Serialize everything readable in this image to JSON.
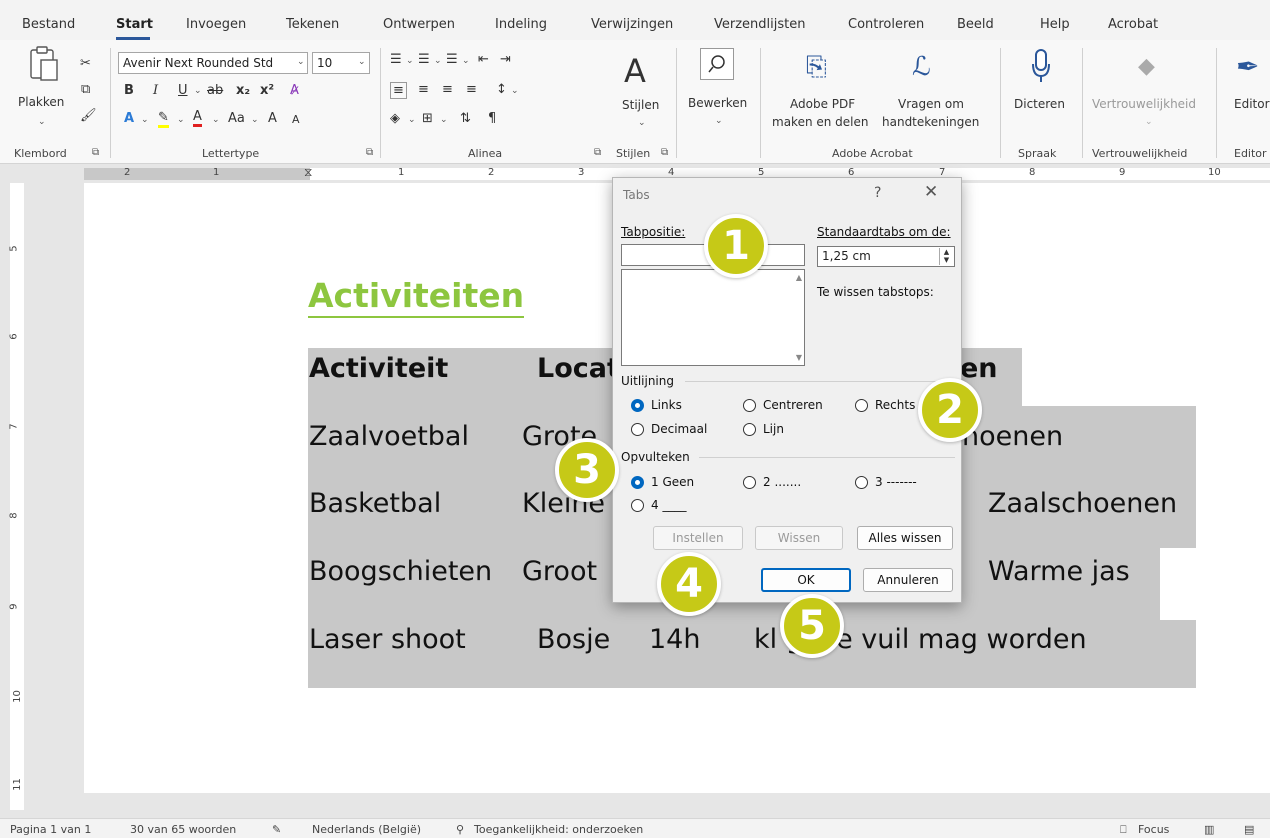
{
  "menu": {
    "tabs": [
      "Bestand",
      "Start",
      "Invoegen",
      "Tekenen",
      "Ontwerpen",
      "Indeling",
      "Verwijzingen",
      "Verzendlijsten",
      "Controleren",
      "Beeld",
      "Help",
      "Acrobat"
    ],
    "active": "Start"
  },
  "ribbon": {
    "clipboard": {
      "paste_label": "Plakken",
      "group_label": "Klembord"
    },
    "font": {
      "font_name": "Avenir Next Rounded Std",
      "font_size": "10",
      "group_label": "Lettertype",
      "bold": "B",
      "italic": "I",
      "underline": "U",
      "strike": "ab",
      "change_case": "Aa",
      "grow": "A",
      "shrink": "A"
    },
    "paragraph": {
      "group_label": "Alinea",
      "pilcrow": "¶"
    },
    "styles": {
      "label": "Stijlen",
      "group_label": "Stijlen"
    },
    "editing": {
      "label": "Bewerken"
    },
    "acrobat": {
      "pdf_label_1": "Adobe PDF",
      "pdf_label_2": "maken en delen",
      "sign_label_1": "Vragen om",
      "sign_label_2": "handtekeningen",
      "group_label": "Adobe Acrobat"
    },
    "voice": {
      "label": "Dicteren",
      "group_label": "Spraak"
    },
    "sensitivity": {
      "label": "Vertrouwelijkheid",
      "group_label": "Vertrouwelijkheid"
    },
    "editor": {
      "label": "Editor",
      "group_label": "Editor"
    }
  },
  "ruler": {
    "numbers": [
      "2",
      "1",
      "1",
      "2",
      "3",
      "4",
      "5",
      "6",
      "7",
      "8",
      "9",
      "10"
    ]
  },
  "vruler": {
    "numbers": [
      "5",
      "6",
      "7",
      "8",
      "9",
      "10",
      "11"
    ]
  },
  "document": {
    "heading": "Activiteiten",
    "rows": [
      {
        "a": "Activiteit",
        "b": "Locat",
        "c": "",
        "d": "en"
      },
      {
        "a": "Zaalvoetbal",
        "b": "Grote",
        "c": "",
        "d": "noenen"
      },
      {
        "a": "Basketbal",
        "b": "Kleine",
        "c": "",
        "d": "Zaalschoenen"
      },
      {
        "a": "Boogschieten",
        "b": "Groot",
        "c": "",
        "d": "Warme jas"
      },
      {
        "a": "Laser shoot",
        "b": "Bosje",
        "c": "14h",
        "d": "kl    g die vuil mag worden"
      }
    ]
  },
  "dialog": {
    "title": "Tabs",
    "help": "?",
    "close": "✕",
    "tab_position_label": "Tabpositie:",
    "tab_position_value": "",
    "default_tabs_label": "Standaardtabs om de:",
    "default_tabs_value": "1,25 cm",
    "clear_label": "Te wissen tabstops:",
    "alignment": {
      "title": "Uitlijning",
      "options": [
        "Links",
        "Centreren",
        "Rechts",
        "Decimaal",
        "Lijn"
      ],
      "selected": "Links"
    },
    "leader": {
      "title": "Opvulteken",
      "options": [
        "1 Geen",
        "2 .......",
        "3 -------",
        "4 ____"
      ],
      "selected": "1 Geen"
    },
    "buttons": {
      "set": "Instellen",
      "clear": "Wissen",
      "clear_all": "Alles wissen",
      "ok": "OK",
      "cancel": "Annuleren"
    }
  },
  "callouts": [
    "1",
    "2",
    "3",
    "4",
    "5"
  ],
  "status": {
    "page": "Pagina 1 van 1",
    "words": "30 van 65 woorden",
    "language": "Nederlands (België)",
    "accessibility": "Toegankelijkheid: onderzoeken",
    "focus": "Focus"
  },
  "colors": {
    "accent": "#2b579a",
    "heading_green": "#8dc63f",
    "callout": "#c6c917",
    "radio_blue": "#0067c0"
  }
}
